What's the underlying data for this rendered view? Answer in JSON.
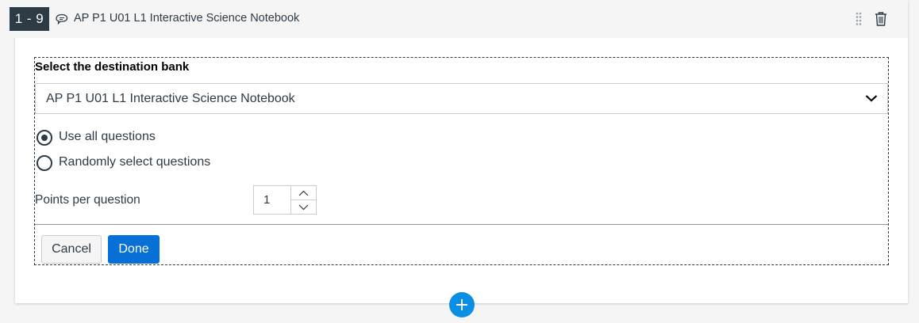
{
  "header": {
    "range": "1 - 9",
    "bank_icon": "bank-icon",
    "title": "AP P1 U01 L1 Interactive Science Notebook",
    "drag_icon": "drag-handle-icon",
    "delete_icon": "trash-icon"
  },
  "form": {
    "label": "Select the destination bank",
    "select": {
      "value": "AP P1 U01 L1 Interactive Science Notebook",
      "icon": "chevron-down-icon"
    },
    "options": [
      {
        "label": "Use all questions",
        "checked": true
      },
      {
        "label": "Randomly select questions",
        "checked": false
      }
    ],
    "points": {
      "label": "Points per question",
      "value": "1"
    },
    "cancel_label": "Cancel",
    "done_label": "Done"
  },
  "add_icon": "plus-icon",
  "colors": {
    "primary": "#0770d6",
    "add": "#0b8fe5",
    "text": "#2d3b45",
    "badge": "#2d3b45"
  }
}
